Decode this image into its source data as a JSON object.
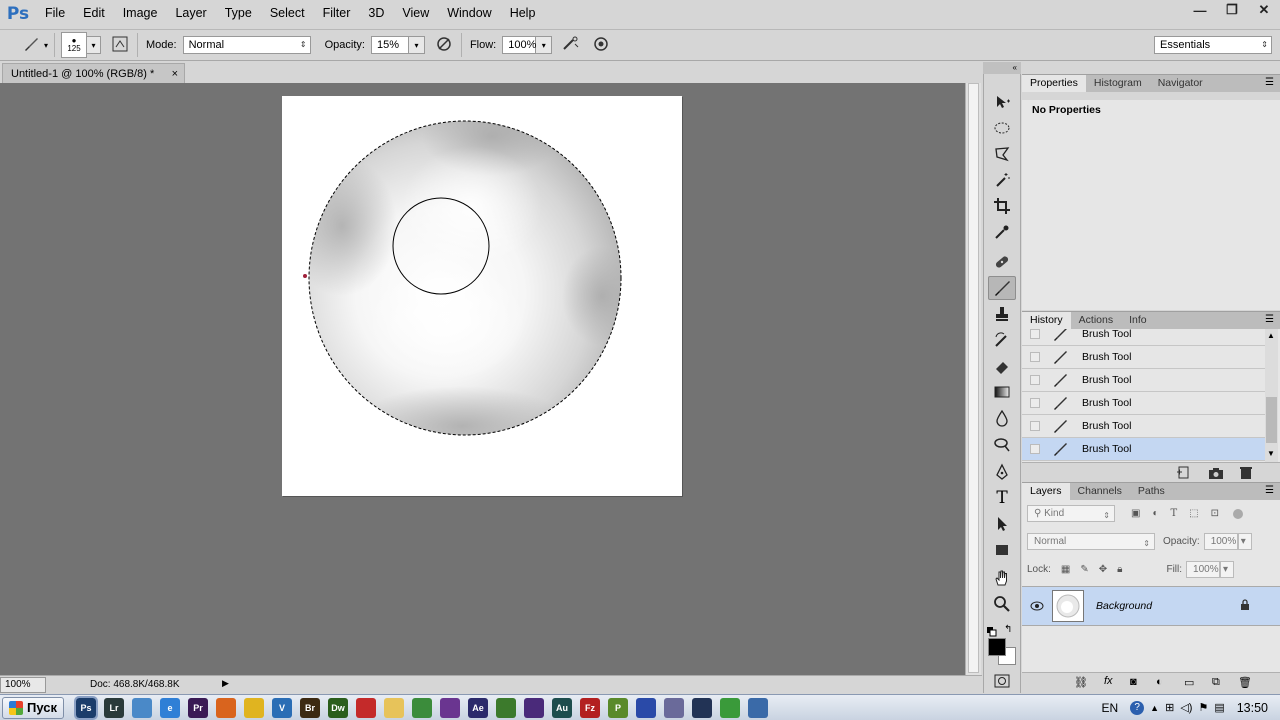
{
  "app": {
    "logo": "Ps"
  },
  "menu": [
    "File",
    "Edit",
    "Image",
    "Layer",
    "Type",
    "Select",
    "Filter",
    "3D",
    "View",
    "Window",
    "Help"
  ],
  "window_controls": {
    "minimize": "—",
    "restore": "❐",
    "close": "✕"
  },
  "options": {
    "brush_size": "125",
    "mode_label": "Mode:",
    "mode_value": "Normal",
    "opacity_label": "Opacity:",
    "opacity_value": "15%",
    "flow_label": "Flow:",
    "flow_value": "100%",
    "workspace": "Essentials"
  },
  "document": {
    "tab_title": "Untitled-1 @ 100% (RGB/8) *",
    "close": "×"
  },
  "status": {
    "zoom": "100%",
    "doc_info": "Doc: 468.8K/468.8K",
    "arrow": "▶"
  },
  "tools_header": "«",
  "tools": [
    "move-icon",
    "ellipse-marquee-icon",
    "lasso-icon",
    "magic-wand-icon",
    "crop-icon",
    "eyedropper-icon",
    "healing-brush-icon",
    "brush-icon",
    "clone-stamp-icon",
    "history-brush-icon",
    "eraser-icon",
    "gradient-icon",
    "blur-icon",
    "dodge-icon",
    "pen-icon",
    "type-icon",
    "path-selection-icon",
    "rectangle-icon",
    "hand-icon",
    "zoom-icon"
  ],
  "properties": {
    "tabs": [
      "Properties",
      "Histogram",
      "Navigator"
    ],
    "body_text": "No Properties"
  },
  "history": {
    "tabs": [
      "History",
      "Actions",
      "Info"
    ],
    "items": [
      "Brush Tool",
      "Brush Tool",
      "Brush Tool",
      "Brush Tool",
      "Brush Tool",
      "Brush Tool"
    ]
  },
  "layers": {
    "tabs": [
      "Layers",
      "Channels",
      "Paths"
    ],
    "filter_kind": "Kind",
    "blend_mode": "Normal",
    "opacity_label": "Opacity:",
    "opacity_value": "100%",
    "lock_label": "Lock:",
    "fill_label": "Fill:",
    "fill_value": "100%",
    "layer_name": "Background"
  },
  "taskbar": {
    "start_label": "Пуск",
    "apps": [
      {
        "name": "photoshop",
        "label": "Ps",
        "color": "#1b3d6b"
      },
      {
        "name": "lightroom",
        "label": "Lr",
        "color": "#2a3a3a"
      },
      {
        "name": "browser-1",
        "label": "",
        "color": "#4a89c8"
      },
      {
        "name": "internet-explorer",
        "label": "e",
        "color": "#2f7fd6"
      },
      {
        "name": "premiere",
        "label": "Pr",
        "color": "#3a1a55"
      },
      {
        "name": "firefox",
        "label": "",
        "color": "#d9641e"
      },
      {
        "name": "app-yellow",
        "label": "",
        "color": "#e0b420"
      },
      {
        "name": "app-v",
        "label": "V",
        "color": "#2a6db5"
      },
      {
        "name": "bridge",
        "label": "Br",
        "color": "#3d2a12"
      },
      {
        "name": "dreamweaver",
        "label": "Dw",
        "color": "#2b5e1c"
      },
      {
        "name": "opera",
        "label": "",
        "color": "#c42a2a"
      },
      {
        "name": "explorer",
        "label": "",
        "color": "#e7c35a"
      },
      {
        "name": "charts-app",
        "label": "",
        "color": "#3b8c3b"
      },
      {
        "name": "app-purple",
        "label": "",
        "color": "#6a3590"
      },
      {
        "name": "after-effects",
        "label": "Ae",
        "color": "#2b2a6b"
      },
      {
        "name": "app-green",
        "label": "",
        "color": "#3c7a2c"
      },
      {
        "name": "app-violet",
        "label": "",
        "color": "#4a2a7a"
      },
      {
        "name": "audition",
        "label": "Au",
        "color": "#1d4d4d"
      },
      {
        "name": "filezilla",
        "label": "Fz",
        "color": "#b32020"
      },
      {
        "name": "publisher",
        "label": "P",
        "color": "#5a8a2a"
      },
      {
        "name": "app-blue",
        "label": "",
        "color": "#2a4aa8"
      },
      {
        "name": "app-arrow",
        "label": "",
        "color": "#6a6a9a"
      },
      {
        "name": "app-circle",
        "label": "",
        "color": "#223355"
      },
      {
        "name": "app-green-circle",
        "label": "",
        "color": "#3a9a3a"
      },
      {
        "name": "app-globe",
        "label": "",
        "color": "#3a6aa8"
      }
    ],
    "lang": "EN",
    "clock": "13:50"
  },
  "colors": {
    "foreground": "#000000",
    "background": "#ffffff",
    "selection": "#c4d7f2",
    "canvas_bg": "#737373"
  }
}
